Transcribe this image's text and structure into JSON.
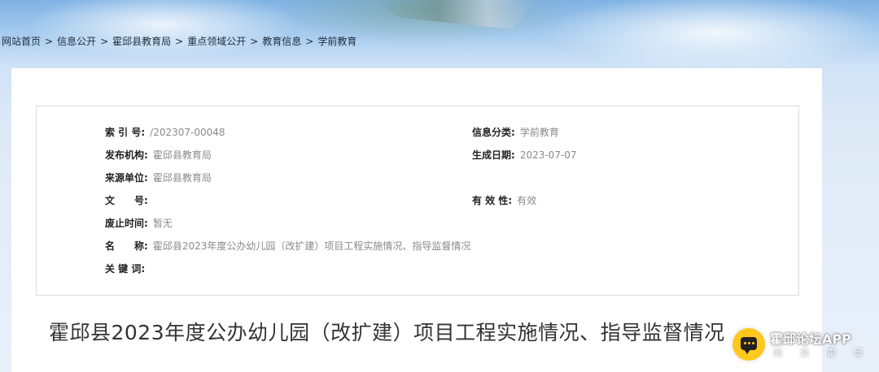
{
  "breadcrumb": [
    {
      "label": "网站首页"
    },
    {
      "label": "信息公开"
    },
    {
      "label": "霍邱县教育局"
    },
    {
      "label": "重点领域公开"
    },
    {
      "label": "教育信息"
    },
    {
      "label": "学前教育"
    }
  ],
  "breadcrumb_separator": ">",
  "meta": {
    "index_no": {
      "label": "索 引 号:",
      "value": "/202307-00048"
    },
    "category": {
      "label": "信息分类:",
      "value": "学前教育"
    },
    "publisher": {
      "label": "发布机构:",
      "value": "霍邱县教育局"
    },
    "generated_date": {
      "label": "生成日期:",
      "value": "2023-07-07"
    },
    "source": {
      "label": "来源单位:",
      "value": "霍邱县教育局"
    },
    "doc_no": {
      "label": "文　　号:",
      "value": ""
    },
    "validity": {
      "label": "有 效 性:",
      "value": "有效"
    },
    "abolish_time": {
      "label": "废止时间:",
      "value": "暂无"
    },
    "name": {
      "label": "名　　称:",
      "value": "霍邱县2023年度公办幼儿园（改扩建）项目工程实施情况、指导监督情况"
    },
    "keywords": {
      "label": "关 键 词:",
      "value": ""
    }
  },
  "article": {
    "title": "霍邱县2023年度公办幼儿园（改扩建）项目工程实施情况、指导监督情况"
  },
  "watermark": {
    "app_name": "霍邱论坛APP",
    "tagline": "阅读霍邱",
    "icon": "chat-bubble-icon",
    "accent": "#ffc81e"
  }
}
